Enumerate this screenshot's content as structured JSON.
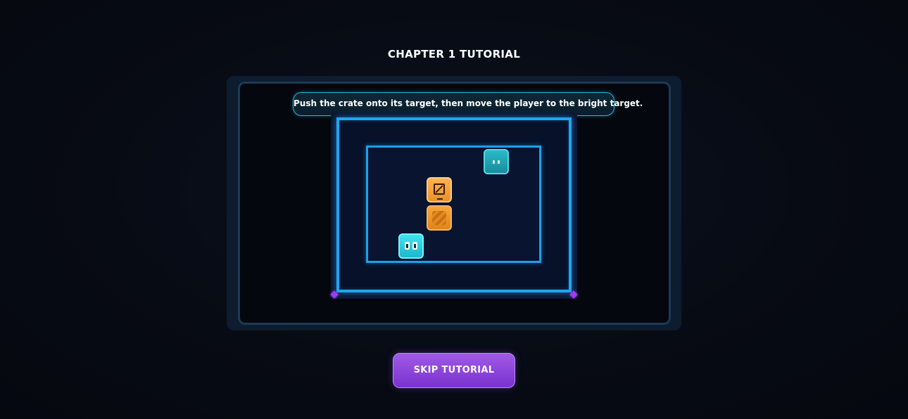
{
  "header": {
    "title": "CHAPTER 1 TUTORIAL"
  },
  "instruction": {
    "text": "Push the crate onto its target, then move the player to the bright target."
  },
  "board": {
    "grid_columns": 6,
    "grid_rows": 4,
    "pieces": [
      {
        "type": "player-target",
        "icon": "player-target-icon",
        "col": 4,
        "row": 0
      },
      {
        "type": "crate",
        "icon": "crate-icon",
        "col": 2,
        "row": 1
      },
      {
        "type": "crate-target",
        "icon": "crate-target-icon",
        "col": 2,
        "row": 2
      },
      {
        "type": "player",
        "icon": "player-icon",
        "col": 1,
        "row": 3
      }
    ]
  },
  "colors": {
    "board_border": "#1ea6f0",
    "player": "#2ad0e0",
    "crate": "#f5a03a",
    "accent": "#9b3df0"
  },
  "actions": {
    "skip_label": "SKIP TUTORIAL"
  }
}
